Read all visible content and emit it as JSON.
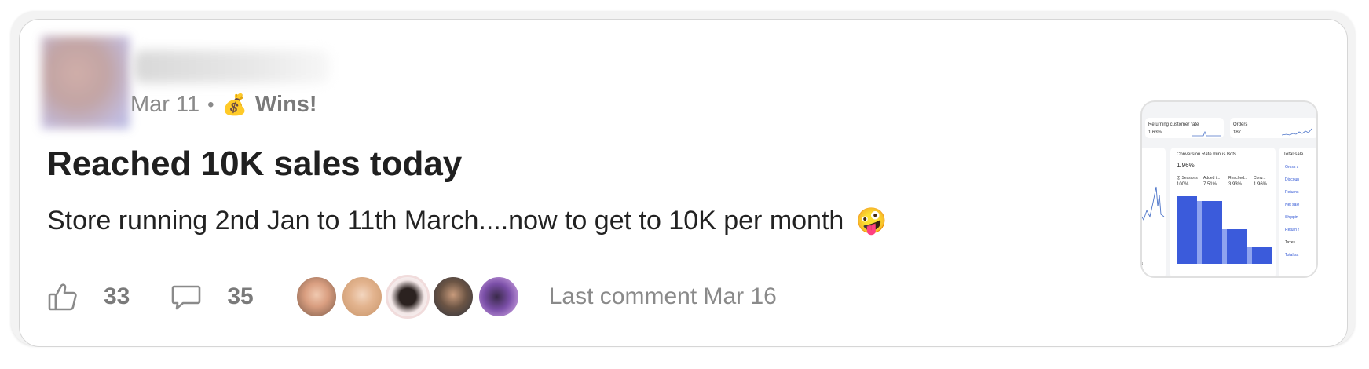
{
  "post": {
    "date": "Mar 11",
    "separator": "•",
    "category_icon": "money-bag-icon",
    "category_emoji": "💰",
    "category": "Wins!",
    "title": "Reached 10K sales today",
    "body": "Store running 2nd Jan to 11th March....now to get to 10K per month",
    "body_emoji": "🤪"
  },
  "footer": {
    "likes": "33",
    "comments": "35",
    "last_comment": "Last comment Mar 16",
    "commenter_avatars": 5
  },
  "thumbnail": {
    "returning_label": "Returning customer rate",
    "returning_value": "1.63%",
    "orders_label": "Orders",
    "orders_value": "187",
    "conversion_label": "Conversion Rate minus Bots",
    "conversion_value": "1.96%",
    "funnel": [
      {
        "label": "Sessions",
        "value": "100%"
      },
      {
        "label": "Added t...",
        "value": "7.51%"
      },
      {
        "label": "Reached...",
        "value": "3.93%"
      },
      {
        "label": "Conv...",
        "value": "1.96%"
      }
    ],
    "total_sales_label": "Total sale",
    "sales_links": [
      "Gross s",
      "Discoun",
      "Returns",
      "Net sale",
      "Shippin",
      "Return f",
      "Taxes",
      "Total sa"
    ]
  },
  "colors": {
    "accent_blue": "#3b5bdb",
    "muted_text": "#8a8a8a",
    "title_text": "#202020"
  }
}
